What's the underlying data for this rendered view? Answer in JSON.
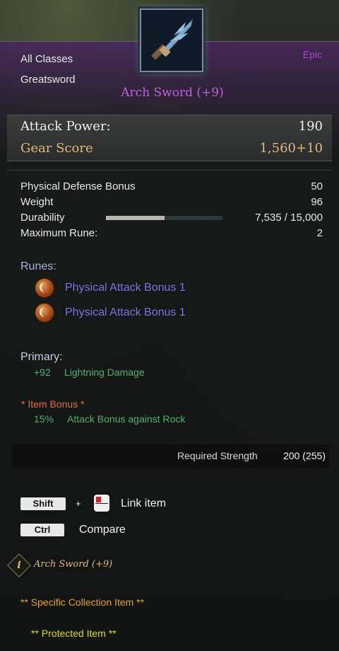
{
  "header": {
    "class_req": "All Classes",
    "weapon_type": "Greatsword",
    "rarity": "Epic",
    "item_name": "Arch Sword (+9)",
    "icon": "greatsword-icon"
  },
  "main_stats": [
    {
      "label": "Attack Power:",
      "value": "190"
    },
    {
      "label": "Gear Score",
      "value": "1,560+10"
    }
  ],
  "stats": [
    {
      "label": "Physical Defense Bonus",
      "value": "50"
    },
    {
      "label": "Weight",
      "value": "96"
    },
    {
      "label": "Durability",
      "value": "7,535 / 15,000"
    },
    {
      "label": "Maximum Rune:",
      "value": "2"
    }
  ],
  "durability_fraction": 0.5,
  "runes": {
    "title": "Runes:",
    "items": [
      {
        "label": "Physical Attack Bonus 1",
        "icon": "rune-icon"
      },
      {
        "label": "Physical Attack Bonus 1",
        "icon": "rune-icon"
      }
    ]
  },
  "primary": {
    "title": "Primary:",
    "value": "+92",
    "label": "Lightning Damage"
  },
  "item_bonus": {
    "title": "*  Item Bonus *",
    "value": "15%",
    "label": "Attack Bonus against Rock"
  },
  "requirement": {
    "label": "Required Strength",
    "value": "200 (255)"
  },
  "shortcuts": {
    "shift_key": "Shift",
    "plus": "+",
    "link_label": "Link item",
    "ctrl_key": "Ctrl",
    "compare_label": "Compare"
  },
  "footer": {
    "info_icon": "info-icon",
    "item_name_italic": "Arch Sword (+9)",
    "collection": "** Specific Collection Item **",
    "protected": "** Protected Item **"
  },
  "colors": {
    "epic": "#b040d0",
    "gold": "#e0b878",
    "rune_label": "#8070e0",
    "primary_title": "#a8b0e0",
    "green": "#50b070",
    "bonus_orange": "#e07040",
    "collection": "#e0a030",
    "protected": "#d8d820"
  }
}
